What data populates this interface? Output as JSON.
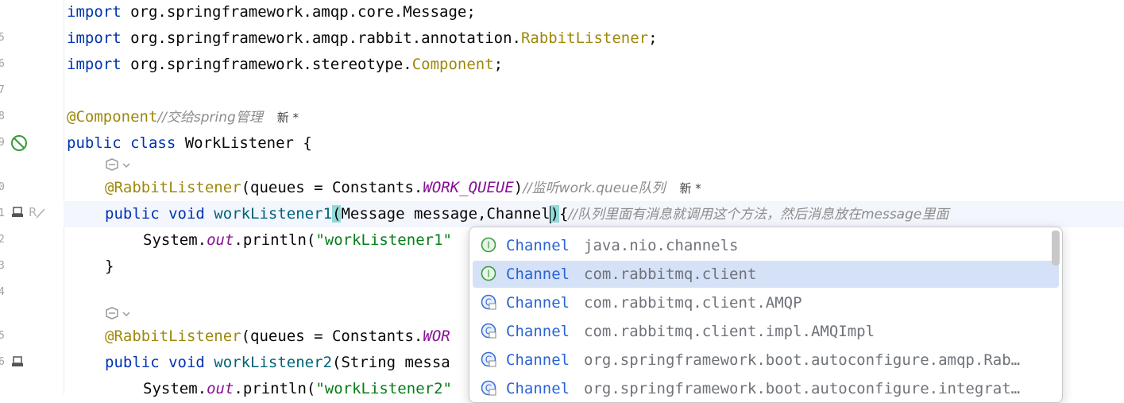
{
  "editor": {
    "lines": {
      "import1": {
        "kw": "import",
        "rest": " org.springframework.amqp.core.Message;"
      },
      "import2": {
        "kw": "import",
        "rest_a": " org.springframework.amqp.rabbit.annotation.",
        "ann": "RabbitListener",
        "rest_b": ";"
      },
      "import3": {
        "kw": "import",
        "rest_a": " org.springframework.stereotype.",
        "ann": "Component",
        "rest_b": ";"
      },
      "component": {
        "ann": "@Component",
        "comment": "//交给spring管理",
        "hint": "新 *"
      },
      "class_decl": {
        "kw": "public class",
        "rest": " WorkListener {"
      },
      "listener1": {
        "ann": "@RabbitListener",
        "a": "(queues = Constants.",
        "fld": "WORK_QUEUE",
        "b": ")",
        "comment": "//监听work.queue队列",
        "hint": "新 *"
      },
      "method1": {
        "kw": "public void",
        "fn": "workListener1",
        "paren": "(",
        "a": "Message message,Channel",
        "paren2": ")",
        "b": "{",
        "comment": "//队列里面有消息就调用这个方法，然后消息放在message里面"
      },
      "print1": {
        "a": "System.",
        "fld": "out",
        "b": ".println(",
        "str": "\"workListener1\""
      },
      "close1": {
        "a": "}"
      },
      "listener2": {
        "ann": "@RabbitListener",
        "a": "(queues = Constants.",
        "fld": "WOR"
      },
      "method2": {
        "kw": "public void",
        "fn": "workListener2",
        "a": "(String messa"
      },
      "print2": {
        "a": "System.",
        "fld": "out",
        "b": ".println(",
        "str": "\"workListener2\""
      }
    },
    "line_numbers": [
      "5",
      "6",
      "7",
      "8",
      "9",
      "0",
      "1",
      "2",
      "3",
      "4",
      "5",
      "6"
    ]
  },
  "completion": {
    "items": [
      {
        "name": "Channel",
        "pkg": "java.nio.channels",
        "icon": "interface-icon"
      },
      {
        "name": "Channel",
        "pkg": "com.rabbitmq.client",
        "icon": "interface-icon"
      },
      {
        "name": "Channel",
        "pkg": "com.rabbitmq.client.AMQP",
        "icon": "class-icon"
      },
      {
        "name": "Channel",
        "pkg": "com.rabbitmq.client.impl.AMQImpl",
        "icon": "class-icon"
      },
      {
        "name": "Channel",
        "pkg": "org.springframework.boot.autoconfigure.amqp.Rab…",
        "icon": "class-icon"
      },
      {
        "name": "Channel",
        "pkg": "org.springframework.boot.autoconfigure.integrat…",
        "icon": "class-icon"
      }
    ],
    "selected_index": 1
  },
  "colors": {
    "keyword": "#0033b3",
    "annotation": "#9e880d",
    "comment": "#8c8c8c",
    "string": "#067d17",
    "field": "#871094",
    "method": "#00627a",
    "selection": "#d5e1f7"
  }
}
